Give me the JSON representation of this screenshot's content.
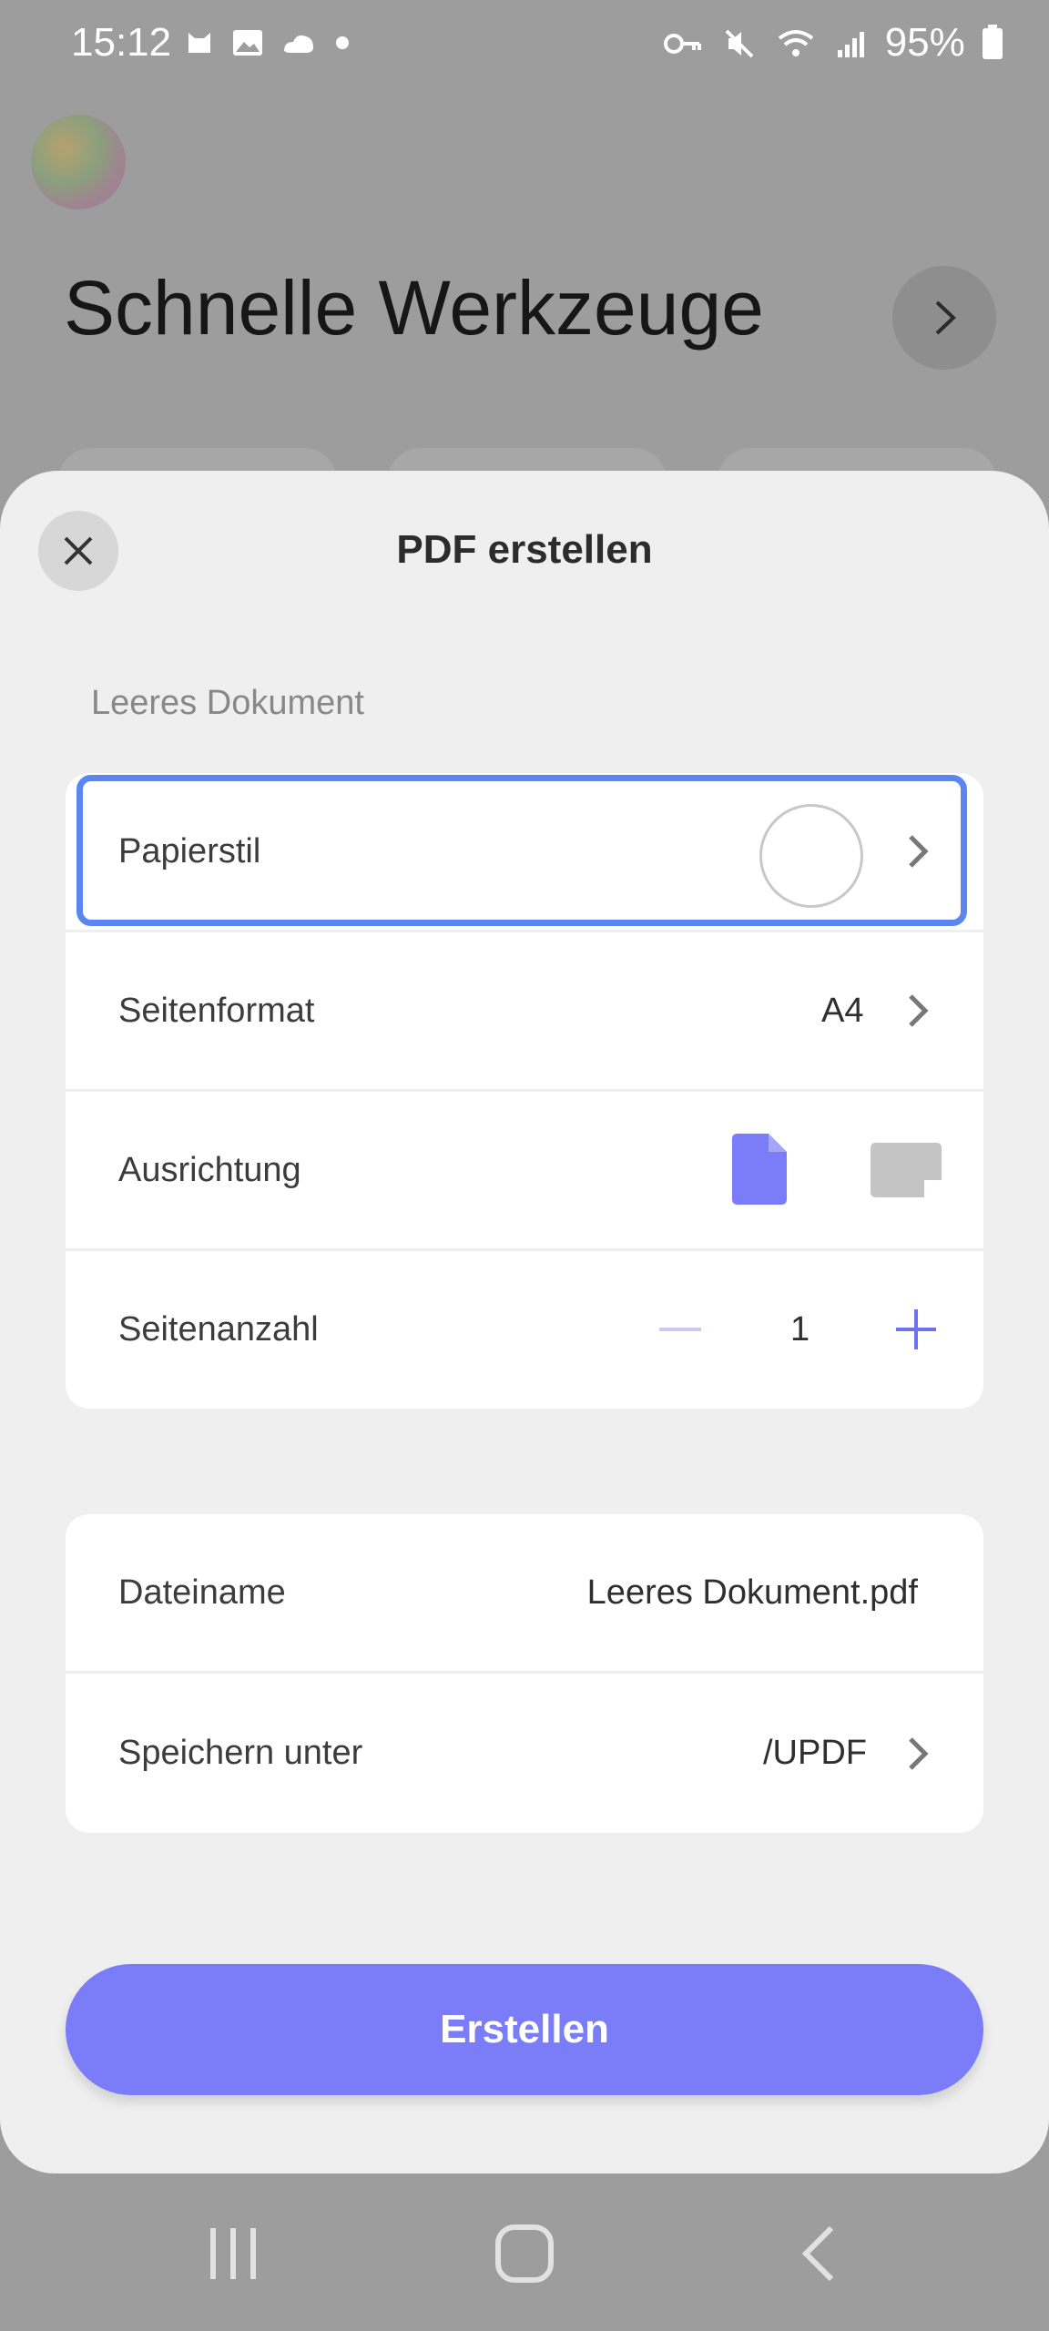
{
  "status": {
    "time": "15:12",
    "battery": "95%",
    "left_icons": [
      "cat-icon",
      "image-icon",
      "cloud-icon",
      "dot-icon"
    ],
    "right_icons": [
      "key-icon",
      "mute-icon",
      "wifi-icon",
      "signal-icon",
      "battery-icon"
    ]
  },
  "background": {
    "title": "Schnelle Werkzeuge"
  },
  "sheet": {
    "title": "PDF erstellen",
    "section_label": "Leeres Dokument",
    "rows": {
      "paper_style": {
        "label": "Papierstil"
      },
      "page_format": {
        "label": "Seitenformat",
        "value": "A4"
      },
      "orientation": {
        "label": "Ausrichtung",
        "selected": "portrait"
      },
      "page_count": {
        "label": "Seitenanzahl",
        "value": "1"
      },
      "file_name": {
        "label": "Dateiname",
        "value": "Leeres Dokument.pdf"
      },
      "save_under": {
        "label": "Speichern unter",
        "value": "/UPDF"
      }
    },
    "create_button": "Erstellen"
  },
  "colors": {
    "accent": "#7a7cf8",
    "highlight": "#5b86f2",
    "sheet_bg": "#efefef",
    "overlay": "#9d9d9d"
  }
}
